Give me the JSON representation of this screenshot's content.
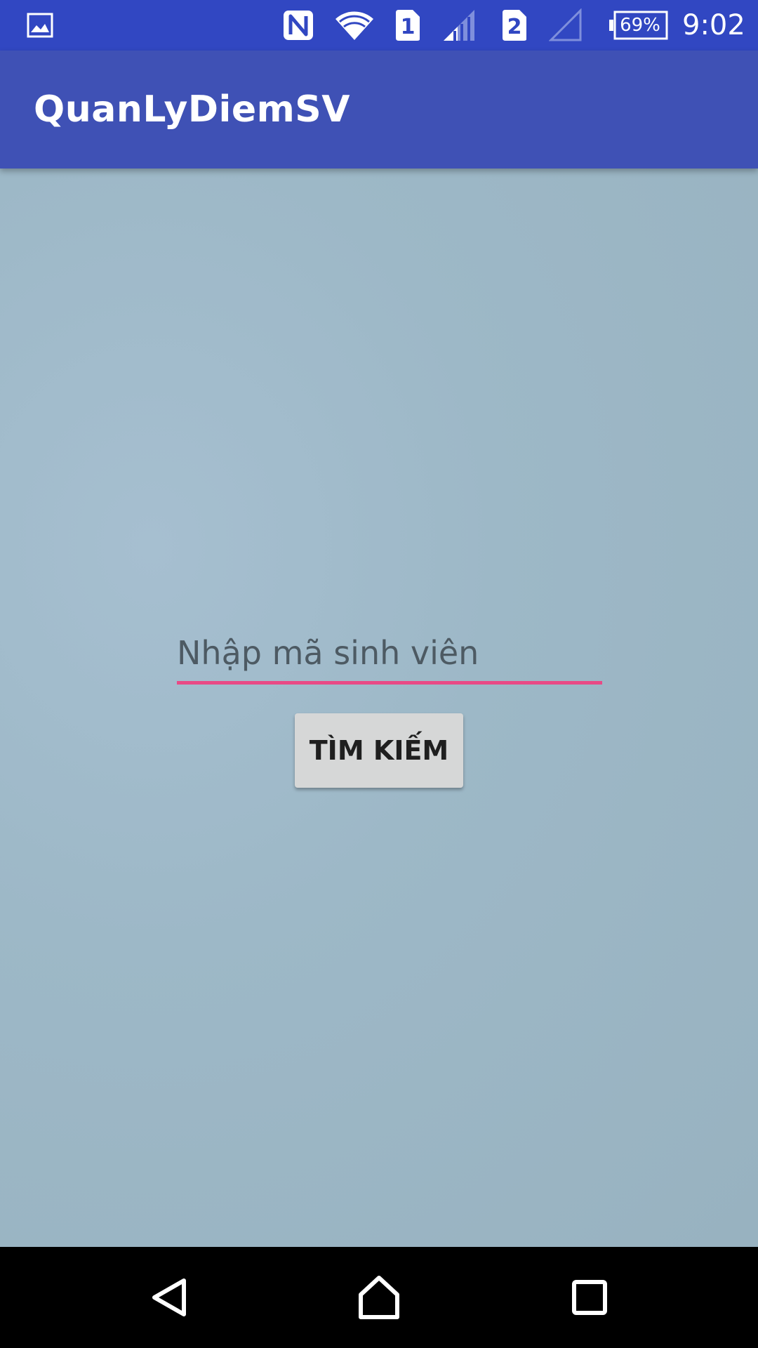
{
  "status_bar": {
    "time": "9:02",
    "battery_percent": "69%",
    "sim1_label": "1",
    "sim2_label": "2",
    "background_color": "#3147c2",
    "icons": [
      "image-notification-icon",
      "nfc-icon",
      "wifi-icon",
      "sim1-icon",
      "signal-icon",
      "sim2-icon",
      "signal-empty-icon",
      "battery-icon"
    ]
  },
  "app_bar": {
    "title": "QuanLyDiemSV",
    "background_color": "#3f51b5"
  },
  "main": {
    "student_id_input": {
      "value": "",
      "placeholder": "Nhập mã sinh viên",
      "underline_color": "#e84a86"
    },
    "search_button_label": "TÌM KIẾM"
  },
  "nav_bar": {
    "icons": [
      "back-icon",
      "home-icon",
      "recents-icon"
    ]
  }
}
